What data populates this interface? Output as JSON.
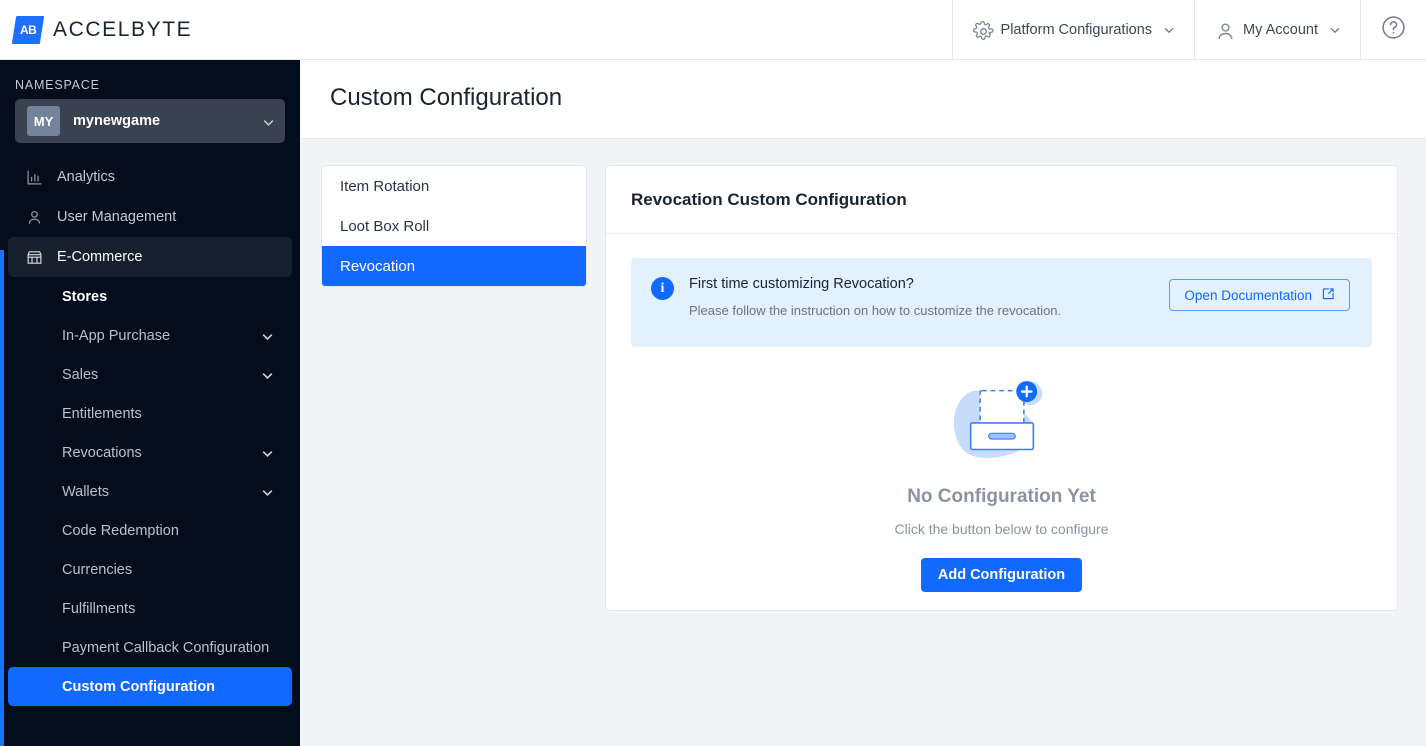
{
  "brand": {
    "mark_text": "AB",
    "name": "ACCELBYTE"
  },
  "topbar": {
    "platform_config": {
      "label": "Platform Configurations",
      "icon": "gear-icon",
      "chevron": "chevron-down-icon"
    },
    "my_account": {
      "label": "My Account",
      "icon": "user-icon",
      "chevron": "chevron-down-icon"
    },
    "help": {
      "icon": "help-circle-icon",
      "label": "?"
    }
  },
  "sidebar": {
    "namespace_label": "NAMESPACE",
    "namespace": {
      "badge": "MY",
      "name": "mynewgame",
      "chevron": "chevron-down-icon"
    },
    "items": [
      {
        "label": "Analytics",
        "icon": "chart-bar-icon",
        "active": false
      },
      {
        "label": "User Management",
        "icon": "user-icon",
        "active": false
      },
      {
        "label": "E-Commerce",
        "icon": "store-icon",
        "active": true
      }
    ],
    "subitems": [
      {
        "label": "Stores",
        "chevron": false,
        "state": "current"
      },
      {
        "label": "In-App Purchase",
        "chevron": true,
        "state": ""
      },
      {
        "label": "Sales",
        "chevron": true,
        "state": ""
      },
      {
        "label": "Entitlements",
        "chevron": false,
        "state": ""
      },
      {
        "label": "Revocations",
        "chevron": true,
        "state": ""
      },
      {
        "label": "Wallets",
        "chevron": true,
        "state": ""
      },
      {
        "label": "Code Redemption",
        "chevron": false,
        "state": ""
      },
      {
        "label": "Currencies",
        "chevron": false,
        "state": ""
      },
      {
        "label": "Fulfillments",
        "chevron": false,
        "state": ""
      },
      {
        "label": "Payment Callback Configuration",
        "chevron": false,
        "state": ""
      },
      {
        "label": "Custom Configuration",
        "chevron": false,
        "state": "selected"
      }
    ]
  },
  "page": {
    "title": "Custom Configuration"
  },
  "config_list": [
    {
      "label": "Item Rotation",
      "active": false
    },
    {
      "label": "Loot Box Roll",
      "active": false
    },
    {
      "label": "Revocation",
      "active": true
    }
  ],
  "panel": {
    "title": "Revocation Custom Configuration",
    "banner": {
      "icon": "info-circle-icon",
      "title": "First time customizing Revocation?",
      "subtitle": "Please follow the instruction on how to customize the revocation.",
      "button_label": "Open Documentation",
      "button_icon": "external-link-icon"
    },
    "empty_state": {
      "illustration": "empty-box-add-illustration",
      "title": "No Configuration Yet",
      "subtitle": "Click the button below to configure",
      "button_label": "Add Configuration"
    }
  },
  "colors": {
    "accent_blue": "#1169ff",
    "sidebar_bg": "#030d1c",
    "sidebar_group_bg": "#16202f",
    "banner_bg": "#e3f0fd",
    "page_bg": "#f3f4f7",
    "muted_text": "#8c93a0"
  }
}
